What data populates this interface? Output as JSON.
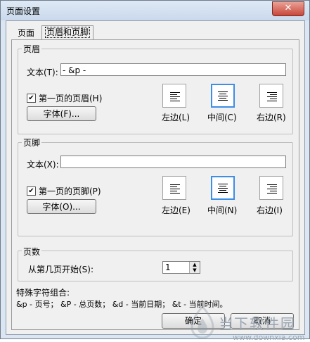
{
  "window": {
    "title": "页面设置",
    "close": "✕"
  },
  "tabs": [
    {
      "label": "页面"
    },
    {
      "label": "页眉和页脚"
    }
  ],
  "header": {
    "group_label": "页眉",
    "text_label": "文本(T):",
    "text_value": "- &p -",
    "first_page_checkbox": {
      "label": "第一页的页眉(H)",
      "checked": true
    },
    "font_button": "字体(F)...",
    "align": [
      {
        "label": "左边(L)"
      },
      {
        "label": "中间(C)"
      },
      {
        "label": "右边(R)"
      }
    ],
    "selected_align": "center"
  },
  "footer": {
    "group_label": "页脚",
    "text_label": "文本(X):",
    "text_value": "",
    "first_page_checkbox": {
      "label": "第一页的页脚(P)",
      "checked": true
    },
    "font_button": "字体(O)...",
    "align": [
      {
        "label": "左边(E)"
      },
      {
        "label": "中间(N)"
      },
      {
        "label": "右边(I)"
      }
    ],
    "selected_align": "center"
  },
  "page_number": {
    "group_label": "页数",
    "start_label": "从第几页开始(S):",
    "start_value": "1"
  },
  "special": {
    "title": "特殊字符组合:",
    "legend": "&p - 页号；  &P - 总页数；  &d - 当前日期；  &t - 当前时间。"
  },
  "buttons": {
    "ok": "确定",
    "cancel": "取消"
  },
  "watermark": {
    "text": "当下软件园",
    "url": "www.downxia.com"
  },
  "icons": [
    "close-icon",
    "align-left-icon",
    "align-center-icon",
    "align-right-icon",
    "spin-up-icon",
    "spin-down-icon"
  ]
}
